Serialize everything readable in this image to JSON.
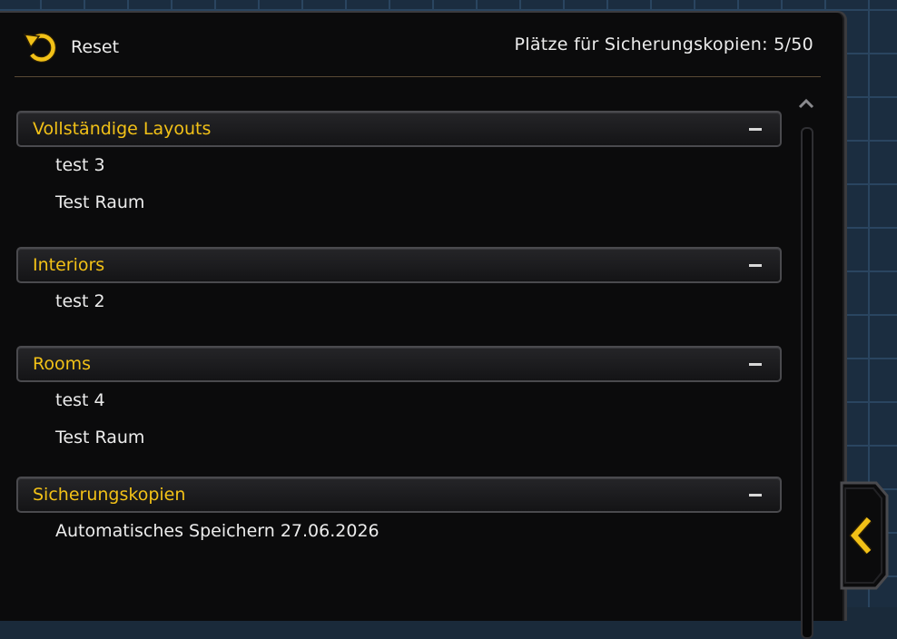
{
  "header": {
    "reset_label": "Reset",
    "slots_text": "Plätze für Sicherungskopien: 5/50"
  },
  "groups": [
    {
      "title": "Vollständige Layouts",
      "items": [
        "test 3",
        "Test Raum"
      ]
    },
    {
      "title": "Interiors",
      "items": [
        "test 2"
      ]
    },
    {
      "title": "Rooms",
      "items": [
        "test 4",
        "Test Raum"
      ]
    },
    {
      "title": "Sicherungskopien",
      "items": [
        "Automatisches Speichern 27.06.2026"
      ]
    }
  ],
  "icons": {
    "reset": "undo-arrow-icon",
    "collapse": "minus-icon",
    "scroll_up": "chevron-up-icon",
    "side_tab": "chevron-left-icon"
  },
  "colors": {
    "accent": "#f2c117",
    "text": "#ececec",
    "panel": "#0b0b0c"
  }
}
